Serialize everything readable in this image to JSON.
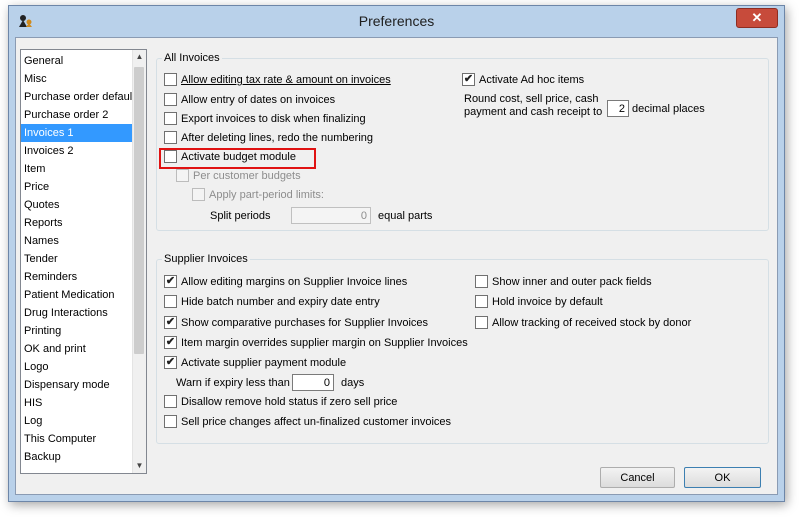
{
  "window": {
    "title": "Preferences",
    "close_glyph": "✕"
  },
  "sidebar": {
    "items": [
      {
        "label": "General"
      },
      {
        "label": "Misc"
      },
      {
        "label": "Purchase order default"
      },
      {
        "label": "Purchase order 2"
      },
      {
        "label": "Invoices 1",
        "selected": true
      },
      {
        "label": "Invoices 2"
      },
      {
        "label": "Item"
      },
      {
        "label": "Price"
      },
      {
        "label": "Quotes"
      },
      {
        "label": "Reports"
      },
      {
        "label": "Names"
      },
      {
        "label": "Tender"
      },
      {
        "label": "Reminders"
      },
      {
        "label": "Patient Medication"
      },
      {
        "label": "Drug Interactions"
      },
      {
        "label": "Printing"
      },
      {
        "label": "OK and print"
      },
      {
        "label": "Logo"
      },
      {
        "label": "Dispensary mode"
      },
      {
        "label": "HIS"
      },
      {
        "label": "Log"
      },
      {
        "label": "This Computer"
      },
      {
        "label": "Backup"
      }
    ],
    "scroll_up_glyph": "▲",
    "scroll_down_glyph": "▼"
  },
  "all_invoices": {
    "title": "All Invoices",
    "allow_edit_tax": {
      "label": "Allow editing tax rate & amount on invoices",
      "checked": false
    },
    "allow_dates": {
      "label": "Allow entry of dates on invoices",
      "checked": false
    },
    "export_disk": {
      "label": "Export invoices to disk when finalizing",
      "checked": false
    },
    "redo_numbering": {
      "label": "After deleting lines, redo the numbering",
      "checked": false
    },
    "budget_module": {
      "label": "Activate budget module",
      "checked": false
    },
    "per_customer": {
      "label": "Per customer budgets",
      "checked": false
    },
    "part_period": {
      "label": "Apply part-period limits:",
      "checked": false
    },
    "split_periods_label": "Split periods",
    "split_periods_value": "0",
    "equal_parts_label": "equal parts",
    "ad_hoc": {
      "label": "Activate Ad hoc items",
      "checked": true
    },
    "round_line1": "Round cost, sell price, cash",
    "round_line2": "payment and cash receipt to",
    "decimal_value": "2",
    "decimal_label": "decimal places"
  },
  "supplier_invoices": {
    "title": "Supplier Invoices",
    "edit_margins": {
      "label": "Allow editing margins on Supplier Invoice lines",
      "checked": true
    },
    "hide_batch": {
      "label": "Hide batch number and expiry date entry",
      "checked": false
    },
    "comparative": {
      "label": "Show comparative purchases for Supplier Invoices",
      "checked": true
    },
    "item_margin": {
      "label": "Item margin overrides supplier margin on Supplier Invoices",
      "checked": true
    },
    "payment_module": {
      "label": "Activate supplier payment module",
      "checked": true
    },
    "warn_label": "Warn if expiry less than",
    "warn_value": "0",
    "days_label": "days",
    "disallow_hold": {
      "label": "Disallow remove hold status if zero sell price",
      "checked": false
    },
    "sell_price_changes": {
      "label": "Sell price changes affect un-finalized customer invoices",
      "checked": false
    },
    "inner_outer": {
      "label": "Show inner and outer pack fields",
      "checked": false
    },
    "hold_default": {
      "label": "Hold invoice by default",
      "checked": false
    },
    "tracking_donor": {
      "label": "Allow tracking of received stock by donor",
      "checked": false
    }
  },
  "buttons": {
    "cancel": "Cancel",
    "ok": "OK"
  },
  "check_glyph": "✔"
}
